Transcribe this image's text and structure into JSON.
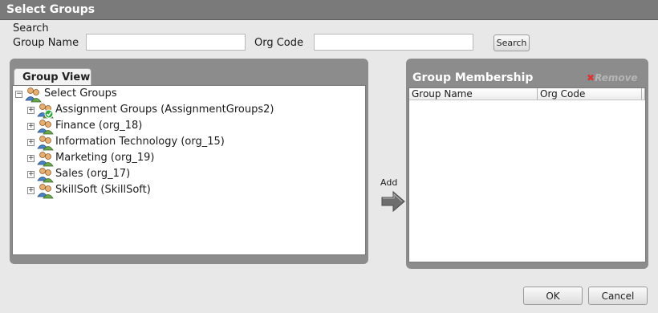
{
  "window": {
    "title": "Select Groups"
  },
  "search": {
    "section_label": "Search",
    "group_name_label": "Group Name",
    "group_name_value": "",
    "org_code_label": "Org Code",
    "org_code_value": "",
    "button_label": "Search"
  },
  "group_view": {
    "tab_label": "Group View",
    "root_label": "Select Groups",
    "items": [
      {
        "label": "Assignment Groups (AssignmentGroups2)",
        "checked": true
      },
      {
        "label": "Finance (org_18)",
        "checked": false
      },
      {
        "label": "Information Technology (org_15)",
        "checked": false
      },
      {
        "label": "Marketing (org_19)",
        "checked": false
      },
      {
        "label": "Sales (org_17)",
        "checked": false
      },
      {
        "label": "SkillSoft (SkillSoft)",
        "checked": false
      }
    ]
  },
  "add": {
    "label": "Add"
  },
  "membership": {
    "title": "Group Membership",
    "remove_label": "Remove",
    "columns": [
      "Group Name",
      "Org Code"
    ]
  },
  "footer": {
    "ok_label": "OK",
    "cancel_label": "Cancel"
  }
}
